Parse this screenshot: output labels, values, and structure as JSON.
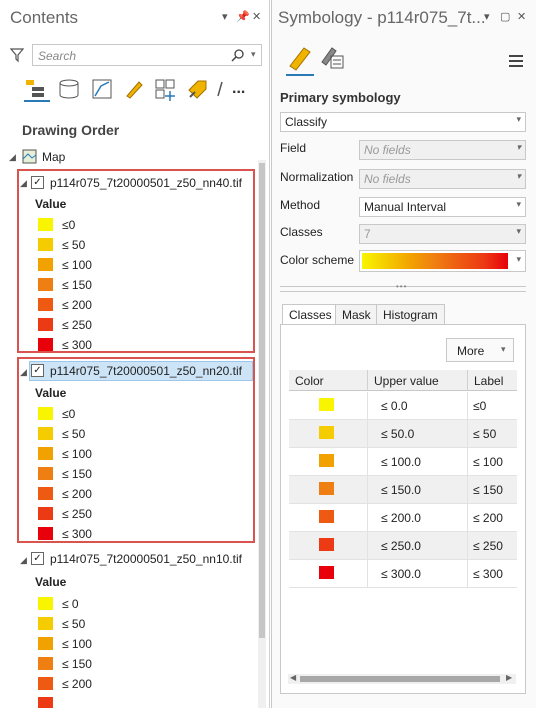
{
  "colors": {
    "c0": "#f9f500",
    "c50": "#f5cc00",
    "c100": "#f2a200",
    "c150": "#ef7f12",
    "c200": "#ee5a11",
    "c250": "#ec3a14",
    "c300": "#e8000b"
  },
  "contents": {
    "title": "Contents",
    "search_placeholder": "Search",
    "toolbar_icons": [
      "list-by-drawing-order-icon",
      "list-by-data-source-icon",
      "list-by-selection-icon",
      "list-by-editing-icon",
      "list-by-snapping-icon",
      "list-by-labeling-icon",
      "more-icon"
    ],
    "more_label": "...",
    "section_title": "Drawing Order",
    "map_label": "Map",
    "layers": [
      {
        "name": "p114r075_7t20000501_z50_nn40.tif",
        "value_header": "Value",
        "labels": [
          "≤0",
          "≤ 50",
          "≤ 100",
          "≤ 150",
          "≤ 200",
          "≤ 250",
          "≤ 300"
        ]
      },
      {
        "name": "p114r075_7t20000501_z50_nn20.tif",
        "value_header": "Value",
        "labels": [
          "≤0",
          "≤ 50",
          "≤ 100",
          "≤ 150",
          "≤ 200",
          "≤ 250",
          "≤ 300"
        ]
      },
      {
        "name": "p114r075_7t20000501_z50_nn10.tif",
        "value_header": "Value",
        "labels": [
          "≤ 0",
          "≤ 50",
          "≤ 100",
          "≤ 150",
          "≤ 200"
        ]
      }
    ]
  },
  "symbology": {
    "title": "Symbology - p114r075_7t...",
    "section_title": "Primary symbology",
    "renderer": "Classify",
    "field_label": "Field",
    "field_value": "No fields",
    "normalization_label": "Normalization",
    "normalization_value": "No fields",
    "method_label": "Method",
    "method_value": "Manual Interval",
    "classes_label": "Classes",
    "classes_value": "7",
    "color_scheme_label": "Color scheme",
    "tabs": [
      "Classes",
      "Mask",
      "Histogram"
    ],
    "more_button": "More",
    "grid_headers": [
      "Color",
      "Upper value",
      "Label"
    ],
    "rows": [
      {
        "upper": "≤   0.0",
        "label": "≤0"
      },
      {
        "upper": "≤   50.0",
        "label": "≤ 50"
      },
      {
        "upper": "≤   100.0",
        "label": "≤ 100"
      },
      {
        "upper": "≤   150.0",
        "label": "≤ 150"
      },
      {
        "upper": "≤   200.0",
        "label": "≤ 200"
      },
      {
        "upper": "≤   250.0",
        "label": "≤ 250"
      },
      {
        "upper": "≤   300.0",
        "label": "≤ 300"
      }
    ]
  }
}
